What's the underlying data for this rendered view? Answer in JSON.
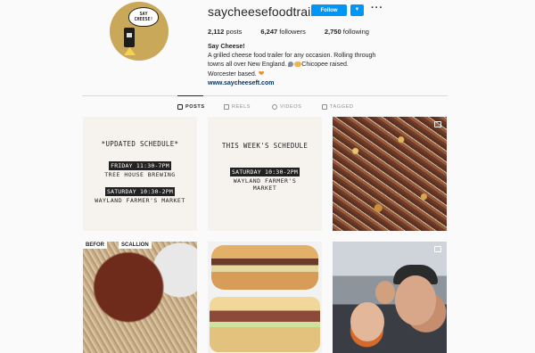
{
  "profile": {
    "username": "saycheesefoodtrailer",
    "follow_label": "Follow",
    "avatar_sign": "SAY CHEESE!",
    "stats": {
      "posts_count": "2,112",
      "posts_label": "posts",
      "followers_count": "6,247",
      "followers_label": "followers",
      "following_count": "2,750",
      "following_label": "following"
    },
    "bio": {
      "name": "Say Cheese!",
      "line1": "A grilled cheese food trailer for any occasion. Rolling through towns all over New England. ",
      "line2": "Chicopee raised. Worcester based. ",
      "link": "www.saycheeseft.com"
    }
  },
  "tabs": [
    {
      "label": "POSTS",
      "icon": "grid-icon",
      "active": true
    },
    {
      "label": "REELS",
      "icon": "reels-icon",
      "active": false
    },
    {
      "label": "VIDEOS",
      "icon": "video-icon",
      "active": false
    },
    {
      "label": "TAGGED",
      "icon": "tag-icon",
      "active": false
    }
  ],
  "posts": {
    "schedule_updated": {
      "heading": "*UPDATED SCHEDULE*",
      "slot1_time": "FRIDAY 11:30-7PM",
      "slot1_place": "TREE HOUSE BREWING",
      "slot2_time": "SATURDAY 10:30-2PM",
      "slot2_place": "WAYLAND FARMER'S MARKET"
    },
    "schedule_week": {
      "heading": "THIS WEEK'S SCHEDULE",
      "slot1_time": "SATURDAY 10:30-2PM",
      "slot1_place_line1": "WAYLAND FARMER'S",
      "slot1_place_line2": "MARKET"
    },
    "bacon_labels": [
      "BEFOR",
      "SCALLION"
    ]
  },
  "colors": {
    "accent": "#0095f6",
    "link": "#00376b",
    "text": "#262626",
    "muted": "#8e8e8e"
  }
}
